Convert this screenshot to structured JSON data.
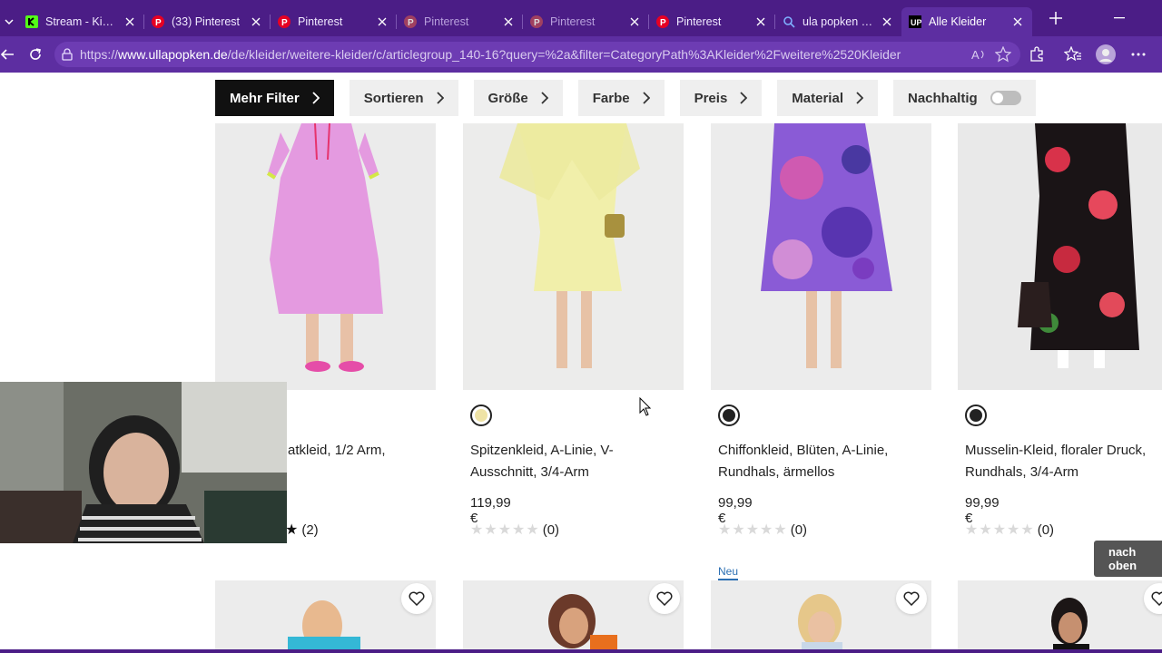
{
  "browser": {
    "tabs": [
      {
        "title": "Stream - Kick D",
        "icon": "kick-icon",
        "state": "normal"
      },
      {
        "title": "(33) Pinterest",
        "icon": "pinterest-icon",
        "state": "normal"
      },
      {
        "title": "Pinterest",
        "icon": "pinterest-icon",
        "state": "normal"
      },
      {
        "title": "Pinterest",
        "icon": "pinterest-icon",
        "state": "dim"
      },
      {
        "title": "Pinterest",
        "icon": "pinterest-icon",
        "state": "dim"
      },
      {
        "title": "Pinterest",
        "icon": "pinterest-icon",
        "state": "normal"
      },
      {
        "title": "ula popken - Su",
        "icon": "search-icon",
        "state": "normal"
      },
      {
        "title": "Alle Kleider",
        "icon": "ullapopken-icon",
        "state": "active"
      }
    ],
    "url_prefix": "https://",
    "url_host": "www.ullapopken.de",
    "url_path": "/de/kleider/weitere-kleider/c/articlegroup_140-16?query=%2a&filter=CategoryPath%3AKleider%2Fweitere%2520Kleider",
    "accent_color": "#4b1d86"
  },
  "filters": {
    "more_filters": "Mehr Filter",
    "sort": "Sortieren",
    "size": "Größe",
    "color": "Farbe",
    "price": "Preis",
    "material": "Material",
    "sustainable": "Nachhaltig"
  },
  "products": [
    {
      "name": "atkleid, 1/2 Arm,",
      "price": "",
      "reviews": "(2)",
      "swatch": ""
    },
    {
      "name": "Spitzenkleid, A-Linie, V-Ausschnitt, 3/4-Arm",
      "price": "119,99 €",
      "reviews": "(0)",
      "swatch": "#efe3a6"
    },
    {
      "name": "Chiffonkleid, Blüten, A-Linie, Rundhals, ärmellos",
      "price": "99,99 €",
      "reviews": "(0)",
      "swatch": "#222222"
    },
    {
      "name": "Musselin-Kleid, floraler Druck, Rundhals, 3/4-Arm",
      "price": "99,99 €",
      "reviews": "(0)",
      "swatch": "#222222"
    }
  ],
  "new_label": "Neu",
  "back_to_top": "nach oben"
}
